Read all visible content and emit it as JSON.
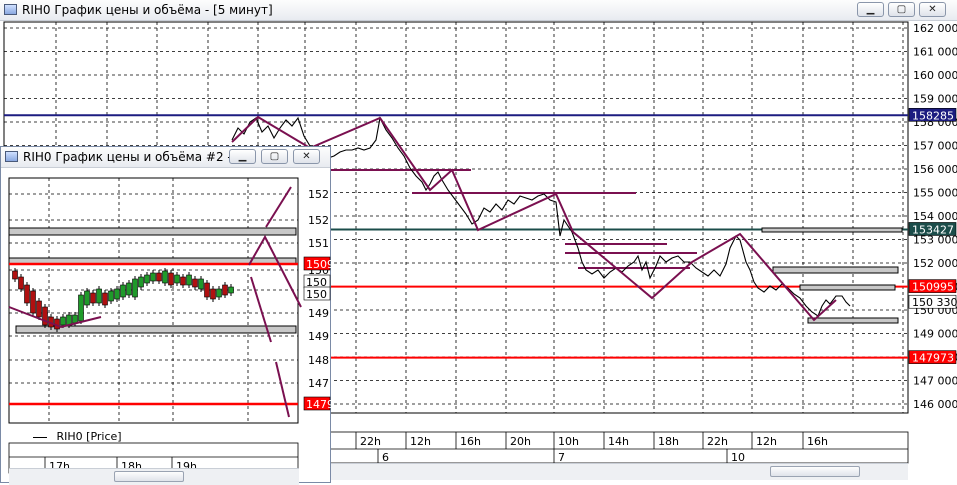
{
  "main_window": {
    "title": "RIH0 График цены и объёма - [5 минут]",
    "buttons": {
      "minimize": "▁",
      "restore": "▢",
      "close": "✕"
    }
  },
  "small_window": {
    "title": "RIH0 График цены и объёма #2 - ...",
    "buttons": {
      "minimize": "▁",
      "restore": "▢",
      "close": "✕"
    },
    "legend": "RIH0 [Price]"
  },
  "colors": {
    "red_level": "#ff0000",
    "navy_level": "#1c1c80",
    "teal_level": "#1b4d4a",
    "zigzag": "#7a1050",
    "grid": "#000000"
  },
  "chart_data": [
    {
      "type": "line",
      "title": "RIH0 График цены и объёма - [5 минут]",
      "y_ticks": [
        "162 000",
        "161 000",
        "160 000",
        "159 000",
        "158 000",
        "157 000",
        "156 000",
        "155 000",
        "154 000",
        "153 000",
        "152 000",
        "151 000",
        "150 000",
        "149 000",
        "148 000",
        "147 000",
        "146 000"
      ],
      "ylim": [
        146000,
        162000
      ],
      "x_time_labels": [
        "22h",
        "12h",
        "16h",
        "20h",
        "10h",
        "14h",
        "18h",
        "22h",
        "12h",
        "16h"
      ],
      "x_date_labels": [
        "6",
        "7",
        "10"
      ],
      "price_labels": [
        {
          "label": "158285",
          "value": 158285,
          "color": "#1c1c80"
        },
        {
          "label": "153427",
          "value": 153427,
          "color": "#1b4d4a"
        },
        {
          "label": "150995",
          "value": 150995,
          "color": "#ff0000"
        },
        {
          "label": "150 330",
          "value": 150330,
          "color": "#ffffff"
        },
        {
          "label": "147973",
          "value": 147973,
          "color": "#ff0000"
        }
      ],
      "horizontal_levels": [
        158285,
        153427,
        150995,
        147973
      ],
      "zigzag_prices": [
        158200,
        157000,
        158200,
        155100,
        153500,
        155000,
        150500,
        153400,
        149600
      ]
    },
    {
      "type": "bar",
      "title": "RIH0 График цены и объёма #2 - ...",
      "y_ticks": [
        "152",
        "152",
        "151",
        "150",
        "150",
        "149",
        "149",
        "148",
        "147"
      ],
      "x_time_labels": [
        "17h",
        "18h",
        "19h"
      ],
      "price_labels": [
        {
          "label": "1509",
          "color": "#ff0000"
        },
        {
          "label": "150",
          "color": "#ffffff"
        },
        {
          "label": "150",
          "color": "#ffffff"
        },
        {
          "label": "1479",
          "color": "#ff0000"
        }
      ],
      "series_name": "RIH0 [Price]"
    }
  ]
}
